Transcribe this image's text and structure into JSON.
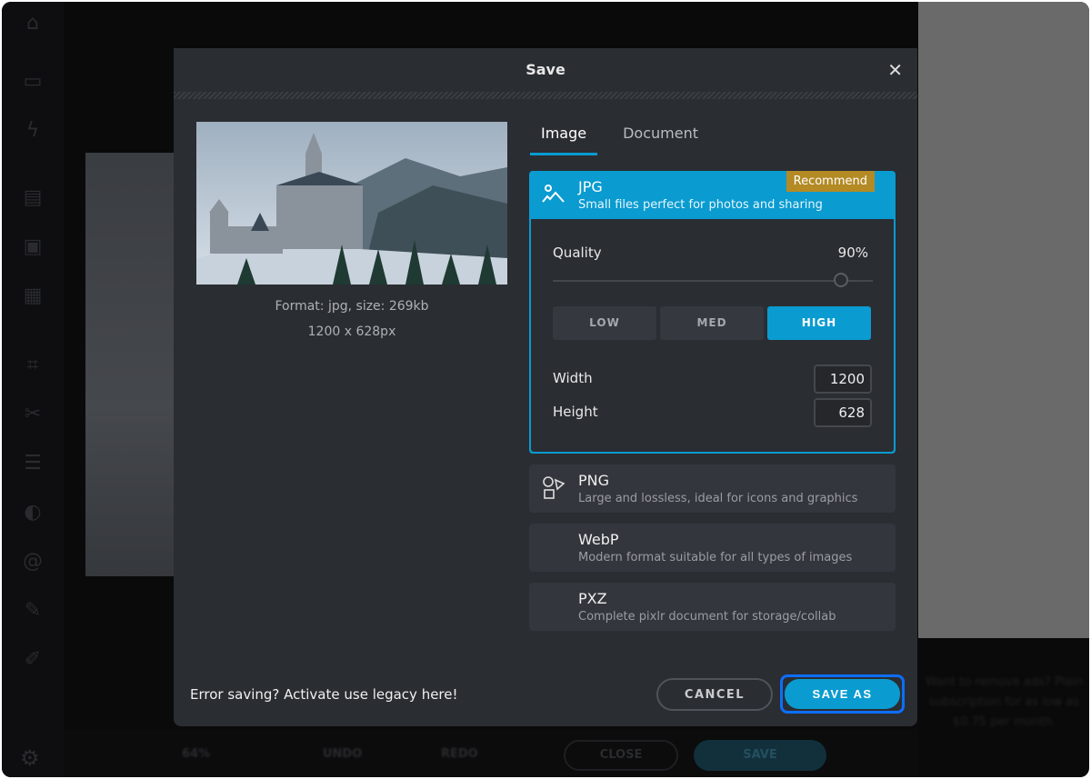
{
  "background": {
    "bottom_bar": {
      "zoom": "64%",
      "undo": "UNDO",
      "redo": "REDO",
      "close": "CLOSE",
      "save": "SAVE"
    },
    "ad_text": "Want to remove ads? Plain subscription for as low as $0.75 per month."
  },
  "dialog": {
    "title": "Save",
    "preview": {
      "format_info": "Format: jpg, size: 269kb",
      "dimensions": "1200 x 628px"
    },
    "tabs": [
      {
        "label": "Image",
        "active": true
      },
      {
        "label": "Document",
        "active": false
      }
    ],
    "formats": [
      {
        "name": "JPG",
        "desc": "Small files perfect for photos and sharing",
        "badge": "Recommend",
        "selected": true,
        "icon": "image-mountain-icon"
      },
      {
        "name": "PNG",
        "desc": "Large and lossless, ideal for icons and graphics",
        "icon": "shapes-icon"
      },
      {
        "name": "WebP",
        "desc": "Modern format suitable for all types of images"
      },
      {
        "name": "PXZ",
        "desc": "Complete pixlr document for storage/collab"
      }
    ],
    "jpg_options": {
      "quality_label": "Quality",
      "quality_value": "90%",
      "quality_percent": 90,
      "presets": [
        "LOW",
        "MED",
        "HIGH"
      ],
      "active_preset": "HIGH",
      "width_label": "Width",
      "width": "1200",
      "height_label": "Height",
      "height": "628"
    },
    "legacy_link": "Error saving? Activate use legacy here!",
    "cancel": "CANCEL",
    "save_as": "SAVE AS"
  },
  "colors": {
    "accent": "#0a9bd0",
    "badge": "#b38a24",
    "dialog_bg": "#2a2d32",
    "focus_ring": "#0d6efd"
  }
}
